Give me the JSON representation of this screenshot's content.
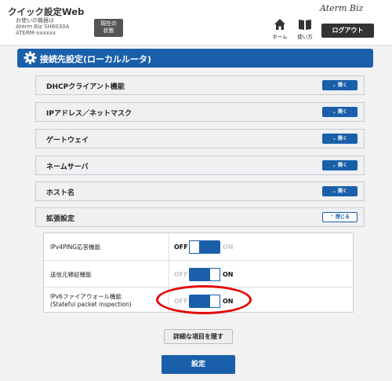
{
  "header": {
    "app_title": "クイック設定Web",
    "device_lines": [
      "お使いの機器は",
      "Aterm Biz SH6030A",
      "ATERM-xxxxxx"
    ],
    "status_button": [
      "現在の",
      "状態"
    ],
    "brand": "Aterm Biz",
    "home_label": "ホーム",
    "help_label": "使い方",
    "logout_label": "ログアウト"
  },
  "section": {
    "title": "接続先設定(ローカルルータ)"
  },
  "panels": [
    {
      "label": "DHCPクライアント機能",
      "button": "開く",
      "state": "collapsed"
    },
    {
      "label": "IPアドレス／ネットマスク",
      "button": "開く",
      "state": "collapsed"
    },
    {
      "label": "ゲートウェイ",
      "button": "開く",
      "state": "collapsed"
    },
    {
      "label": "ネームサーバ",
      "button": "開く",
      "state": "collapsed"
    },
    {
      "label": "ホスト名",
      "button": "開く",
      "state": "collapsed"
    },
    {
      "label": "拡張設定",
      "button": "閉じる",
      "state": "expanded"
    }
  ],
  "settings": [
    {
      "label": [
        "IPv4PING応答機能"
      ],
      "value": "OFF",
      "off": "OFF",
      "on": "ON"
    },
    {
      "label": [
        "送信元検証機能"
      ],
      "value": "ON",
      "off": "OFF",
      "on": "ON"
    },
    {
      "label": [
        "IPv6ファイアウォール機能",
        "(Stateful packet inspection)"
      ],
      "value": "ON",
      "off": "OFF",
      "on": "ON"
    }
  ],
  "buttons": {
    "hide_details": "詳細な項目を隠す",
    "apply": "設定"
  },
  "colors": {
    "accent": "#1a5faa",
    "highlight": "#e60000"
  }
}
